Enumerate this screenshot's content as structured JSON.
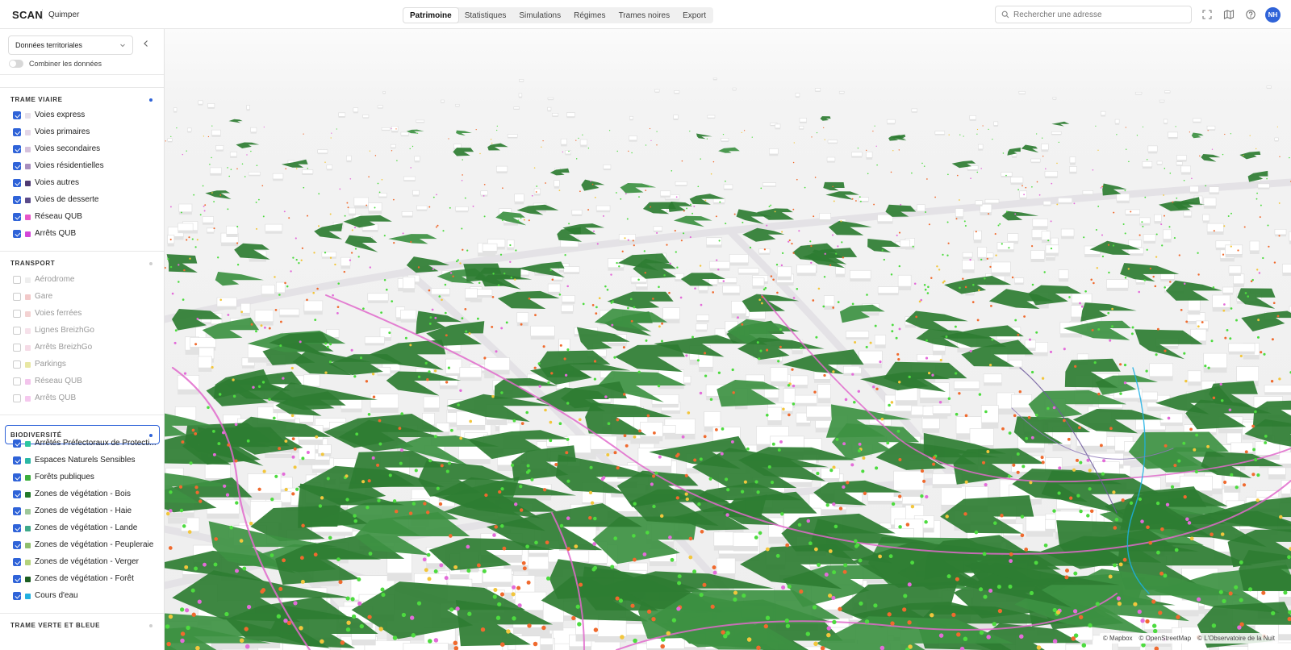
{
  "header": {
    "brand": "SCAN",
    "city": "Quimper",
    "tabs": [
      {
        "label": "Patrimoine",
        "active": true
      },
      {
        "label": "Statistiques",
        "active": false
      },
      {
        "label": "Simulations",
        "active": false
      },
      {
        "label": "Régimes",
        "active": false
      },
      {
        "label": "Trames noires",
        "active": false
      },
      {
        "label": "Export",
        "active": false
      }
    ],
    "search_placeholder": "Rechercher une adresse",
    "icons": [
      "fullscreen-icon",
      "map-icon",
      "help-icon"
    ],
    "avatar_initials": "NH",
    "accent": "#2f63d8"
  },
  "sidebar": {
    "dataset_select": "Données territoriales",
    "combine_label": "Combiner les données",
    "combine_on": false,
    "sections": [
      {
        "title": "TRAME VIAIRE",
        "active": true,
        "layers": [
          {
            "label": "Voies express",
            "checked": true,
            "color": "#e6e0ea"
          },
          {
            "label": "Voies primaires",
            "checked": true,
            "color": "#e3d6e6"
          },
          {
            "label": "Voies secondaires",
            "checked": true,
            "color": "#d6c2dc"
          },
          {
            "label": "Voies résidentielles",
            "checked": true,
            "color": "#a88fbe"
          },
          {
            "label": "Voies autres",
            "checked": true,
            "color": "#4f3a73"
          },
          {
            "label": "Voies de desserte",
            "checked": true,
            "color": "#5b4b8a"
          },
          {
            "label": "Réseau QUB",
            "checked": true,
            "color": "#e857c8"
          },
          {
            "label": "Arrêts QUB",
            "checked": true,
            "color": "#d447d9"
          }
        ]
      },
      {
        "title": "TRANSPORT",
        "active": false,
        "layers": [
          {
            "label": "Aérodrome",
            "checked": false,
            "color": "#eeeeee"
          },
          {
            "label": "Gare",
            "checked": false,
            "color": "#f2c9c9"
          },
          {
            "label": "Voies ferrées",
            "checked": false,
            "color": "#f3d2d2"
          },
          {
            "label": "Lignes BreizhGo",
            "checked": false,
            "color": "#f6e1ea"
          },
          {
            "label": "Arrêts BreizhGo",
            "checked": false,
            "color": "#f5dbe6"
          },
          {
            "label": "Parkings",
            "checked": false,
            "color": "#e8e7a3"
          },
          {
            "label": "Réseau QUB",
            "checked": false,
            "color": "#f3c4ec"
          },
          {
            "label": "Arrêts QUB",
            "checked": false,
            "color": "#f5c8ee"
          }
        ]
      },
      {
        "title": "BIODIVERSITÉ",
        "active": true,
        "layers": [
          {
            "label": "Arrêtés Préfectoraux de Protecti...",
            "checked": true,
            "color": "#2dc6a0"
          },
          {
            "label": "Espaces Naturels Sensibles",
            "checked": true,
            "color": "#2bb8a5"
          },
          {
            "label": "Forêts publiques",
            "checked": true,
            "color": "#3cae3c"
          },
          {
            "label": "Zones de végétation - Bois",
            "checked": true,
            "color": "#237a2b"
          },
          {
            "label": "Zones de végétation - Haie",
            "checked": true,
            "color": "#9ec79a"
          },
          {
            "label": "Zones de végétation - Lande",
            "checked": true,
            "color": "#3fa98a"
          },
          {
            "label": "Zones de végétation - Peupleraie",
            "checked": true,
            "color": "#8fbf6e"
          },
          {
            "label": "Zones de végétation - Verger",
            "checked": true,
            "color": "#b3d27a"
          },
          {
            "label": "Zones de végétation - Forêt",
            "checked": true,
            "color": "#1c5e22"
          },
          {
            "label": "Cours d'eau",
            "checked": true,
            "color": "#22b0e0"
          }
        ]
      },
      {
        "title": "TRAME VERTE ET BLEUE",
        "active": false,
        "layers": []
      }
    ]
  },
  "map": {
    "attribution": [
      "© Mapbox",
      "© OpenStreetMap",
      "© L'Observatoire de la Nuit"
    ]
  }
}
